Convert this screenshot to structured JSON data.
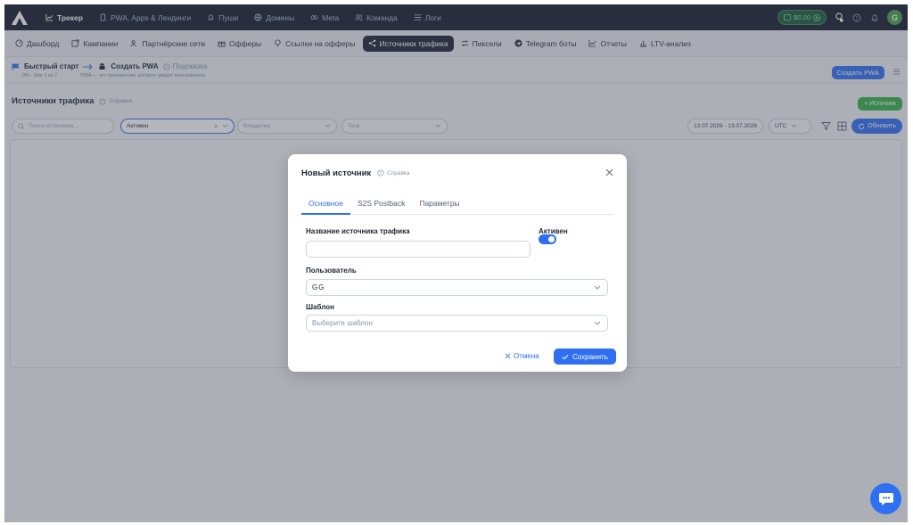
{
  "topnav": {
    "items": [
      {
        "label": "Трекер",
        "active": true
      },
      {
        "label": "PWA, Apps & Лендинги"
      },
      {
        "label": "Пуши"
      },
      {
        "label": "Домены"
      },
      {
        "label": "Meta"
      },
      {
        "label": "Команда"
      },
      {
        "label": "Логи"
      }
    ],
    "balance": "$0.00",
    "avatar_letter": "G"
  },
  "subnav": {
    "items": [
      {
        "label": "Дашборд"
      },
      {
        "label": "Кампании"
      },
      {
        "label": "Партнёрские сети"
      },
      {
        "label": "Офферы"
      },
      {
        "label": "Ссылки на офферы"
      },
      {
        "label": "Источники трафика",
        "active": true
      },
      {
        "label": "Пиксели"
      },
      {
        "label": "Telegram боты"
      },
      {
        "label": "Отчеты"
      },
      {
        "label": "LTV-анализ"
      }
    ]
  },
  "quickstart": {
    "title": "Быстрый старт",
    "step": "Создать PWA",
    "hint": "Подсказка",
    "progress": "0% · Шаг 1 из 7",
    "step_desc": "PWA — это приложение, которое увидит пользователь",
    "button": "Создать PWA"
  },
  "page": {
    "title": "Источники трафика",
    "help": "Справка",
    "add_button": "Источник"
  },
  "filters": {
    "search_placeholder": "Поиск источника...",
    "status_value": "Активен",
    "owner_placeholder": "Владелец",
    "tags_placeholder": "Теги",
    "date_range": "13.07.2026 - 13.07.2026",
    "timezone": "UTC",
    "refresh": "Обновить"
  },
  "modal": {
    "title": "Новый источник",
    "help": "Справка",
    "tabs": [
      "Основное",
      "S2S Postback",
      "Параметры"
    ],
    "active_tab": 0,
    "name_label": "Название источника трафика",
    "name_value": "",
    "active_label": "Активен",
    "active_on": true,
    "user_label": "Пользователь",
    "user_value": "GG",
    "template_label": "Шаблон",
    "template_placeholder": "Выберите шаблон",
    "cancel": "Отмена",
    "save": "Сохранить"
  },
  "colors": {
    "accent": "#2f6ff2",
    "topbar": "#151c2c",
    "success": "#36b24a"
  }
}
